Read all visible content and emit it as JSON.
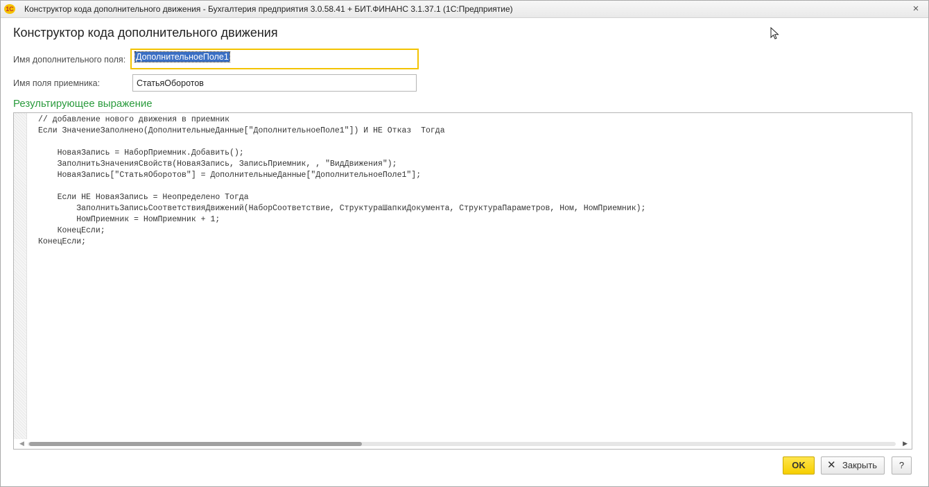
{
  "window": {
    "logo_text": "1С",
    "title": "Конструктор кода дополнительного движения - Бухгалтерия предприятия 3.0.58.41 + БИТ.ФИНАНС 3.1.37.1  (1С:Предприятие)",
    "close_glyph": "×"
  },
  "form": {
    "title": "Конструктор кода дополнительного движения",
    "extra_field_label": "Имя дополнительного поля:",
    "extra_field_value": "ДополнительноеПоле1",
    "receiver_field_label": "Имя поля приемника:",
    "receiver_field_value": "СтатьяОборотов",
    "result_section_title": "Результирующее выражение",
    "code": "// добавление нового движения в приемник\nЕсли ЗначениеЗаполнено(ДополнительныеДанные[\"ДополнительноеПоле1\"]) И НЕ Отказ  Тогда\n\n    НоваяЗапись = НаборПриемник.Добавить();\n    ЗаполнитьЗначенияСвойств(НоваяЗапись, ЗаписьПриемник, , \"ВидДвижения\");\n    НоваяЗапись[\"СтатьяОборотов\"] = ДополнительныеДанные[\"ДополнительноеПоле1\"];\n\n    Если НЕ НоваяЗапись = Неопределено Тогда\n        ЗаполнитьЗаписьСоответствияДвижений(НаборСоответствие, СтруктураШапкиДокумента, СтруктураПараметров, Ном, НомПриемник);\n        НомПриемник = НомПриемник + 1;\n    КонецЕсли;\nКонецЕсли;"
  },
  "buttons": {
    "ok": "OK",
    "close": "Закрыть",
    "close_icon": "✕",
    "help": "?"
  },
  "icons": {
    "mouse_cursor": "mouse-pointer-icon"
  },
  "colors": {
    "section_title": "#2a9b3d",
    "focus_border": "#f3c300",
    "ok_button": "#f6cf00",
    "selection": "#3a6fc4"
  }
}
